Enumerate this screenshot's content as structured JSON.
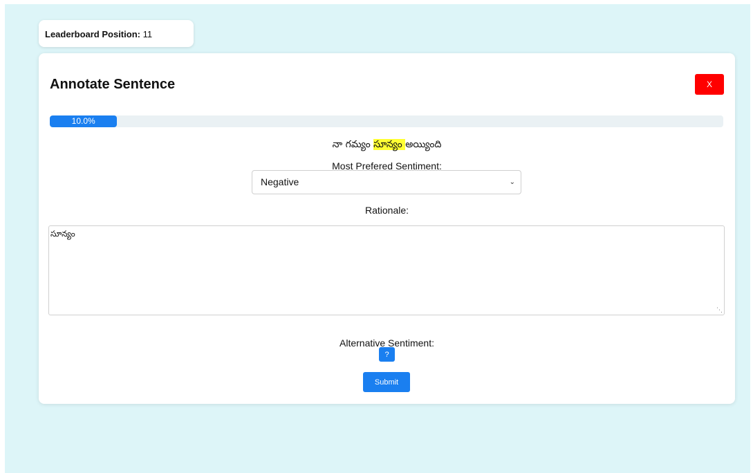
{
  "leaderboard": {
    "label": "Leaderboard Position:",
    "value": "11"
  },
  "card": {
    "title": "Annotate Sentence",
    "close_label": "X"
  },
  "progress": {
    "label": "10.0%",
    "percent": 10
  },
  "sentence": {
    "before": "నా గమ్యం ",
    "highlight": "సూన్యం ",
    "after": "అయ్యింది",
    "highlight_color": "#ffff33"
  },
  "sentiment": {
    "label": "Most Prefered Sentiment:",
    "selected": "Negative"
  },
  "rationale": {
    "label": "Rationale:",
    "value": "సూన్యం"
  },
  "alternative": {
    "label": "Alternative Sentiment:",
    "help_label": "?"
  },
  "submit": {
    "label": "Submit"
  },
  "colors": {
    "background": "#ddf5f8",
    "accent": "#1a7ff0",
    "close": "#ff0000"
  }
}
